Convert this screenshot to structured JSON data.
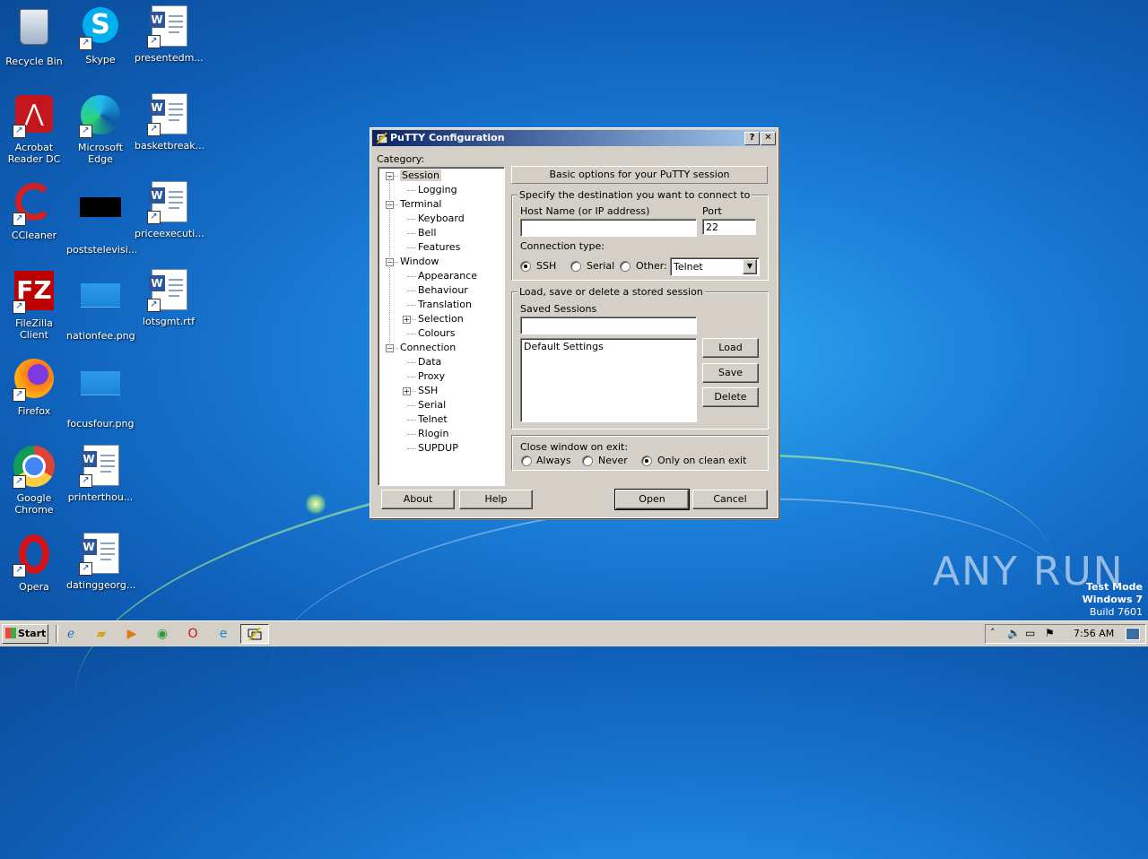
{
  "desktop": {
    "icons": [
      {
        "label": "Recycle Bin",
        "icon": "recycle-bin-icon"
      },
      {
        "label": "Skype",
        "icon": "skype-icon"
      },
      {
        "label": "presentedm...",
        "icon": "word-document-icon"
      },
      {
        "label": "Acrobat Reader DC",
        "icon": "acrobat-icon"
      },
      {
        "label": "Microsoft Edge",
        "icon": "edge-icon"
      },
      {
        "label": "basketbreak...",
        "icon": "word-document-icon"
      },
      {
        "label": "CCleaner",
        "icon": "ccleaner-icon"
      },
      {
        "label": "poststelevisi...",
        "icon": "black-file-icon"
      },
      {
        "label": "priceexecuti...",
        "icon": "word-document-icon"
      },
      {
        "label": "FileZilla Client",
        "icon": "filezilla-icon"
      },
      {
        "label": "nationfee.png",
        "icon": "png-image-icon"
      },
      {
        "label": "lotsgmt.rtf",
        "icon": "word-document-icon"
      },
      {
        "label": "Firefox",
        "icon": "firefox-icon"
      },
      {
        "label": "focusfour.png",
        "icon": "png-image-icon"
      },
      {
        "label": "Google Chrome",
        "icon": "chrome-icon"
      },
      {
        "label": "printerthou...",
        "icon": "word-document-icon"
      },
      {
        "label": "Opera",
        "icon": "opera-icon"
      },
      {
        "label": "datinggeorg...",
        "icon": "word-document-icon"
      }
    ],
    "watermark": {
      "brand": "ANY RUN",
      "line1": "Test Mode",
      "line2": "Windows 7",
      "line3": "Build 7601"
    }
  },
  "window": {
    "title": "PuTTY Configuration",
    "help_btn": "?",
    "close_btn": "✕",
    "category_label": "Category:",
    "tree": [
      {
        "label": "Session",
        "level": 0,
        "expander": "−"
      },
      {
        "label": "Logging",
        "level": 1
      },
      {
        "label": "Terminal",
        "level": 0,
        "expander": "−"
      },
      {
        "label": "Keyboard",
        "level": 1
      },
      {
        "label": "Bell",
        "level": 1
      },
      {
        "label": "Features",
        "level": 1
      },
      {
        "label": "Window",
        "level": 0,
        "expander": "−"
      },
      {
        "label": "Appearance",
        "level": 1
      },
      {
        "label": "Behaviour",
        "level": 1
      },
      {
        "label": "Translation",
        "level": 1
      },
      {
        "label": "Selection",
        "level": 1,
        "expander": "+"
      },
      {
        "label": "Colours",
        "level": 1
      },
      {
        "label": "Connection",
        "level": 0,
        "expander": "−"
      },
      {
        "label": "Data",
        "level": 1
      },
      {
        "label": "Proxy",
        "level": 1
      },
      {
        "label": "SSH",
        "level": 1,
        "expander": "+"
      },
      {
        "label": "Serial",
        "level": 1
      },
      {
        "label": "Telnet",
        "level": 1
      },
      {
        "label": "Rlogin",
        "level": 1
      },
      {
        "label": "SUPDUP",
        "level": 1
      }
    ],
    "panel_header": "Basic options for your PuTTY session",
    "destination": {
      "group_title": "Specify the destination you want to connect to",
      "host_label": "Host Name (or IP address)",
      "host_value": "",
      "port_label": "Port",
      "port_value": "22",
      "conn_type_label": "Connection type:",
      "types": [
        "SSH",
        "Serial",
        "Other:"
      ],
      "selected_type": "SSH",
      "other_value": "Telnet"
    },
    "sessions": {
      "group_title": "Load, save or delete a stored session",
      "saved_label": "Saved Sessions",
      "saved_value": "",
      "list": [
        "Default Settings"
      ],
      "load": "Load",
      "save": "Save",
      "delete": "Delete"
    },
    "close_exit": {
      "label": "Close window on exit:",
      "options": [
        "Always",
        "Never",
        "Only on clean exit"
      ],
      "selected": "Only on clean exit"
    },
    "buttons": {
      "about": "About",
      "help": "Help",
      "open": "Open",
      "cancel": "Cancel"
    }
  },
  "taskbar": {
    "start": "Start",
    "time": "7:56 AM"
  }
}
